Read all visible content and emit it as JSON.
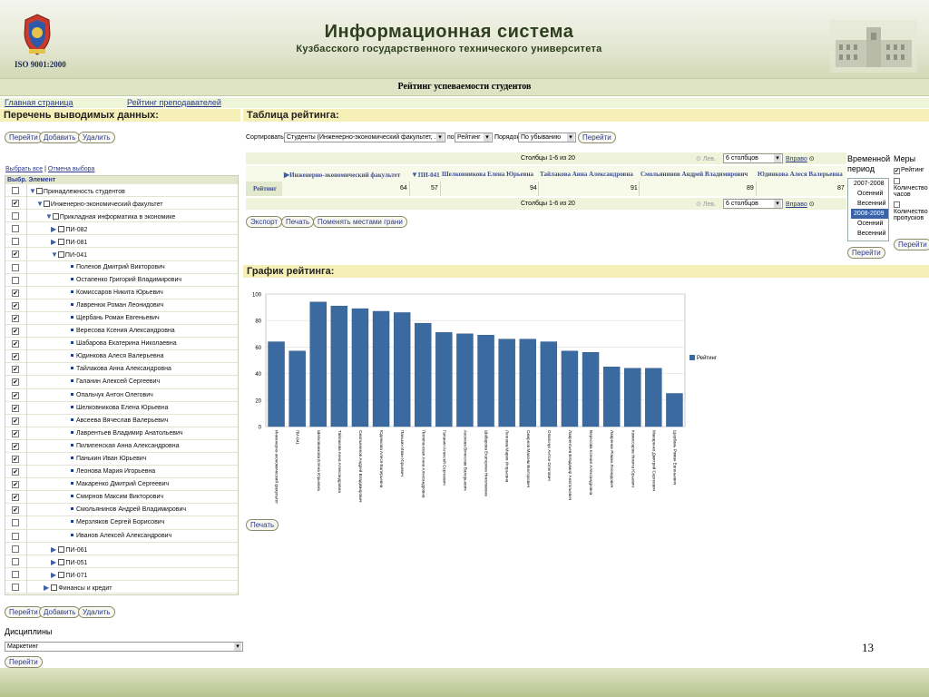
{
  "header": {
    "iso": "ISO 9001:2000",
    "title_line1": "Информационная система",
    "title_line2": "Кузбасского государственного технического университета"
  },
  "page_title": "Рейтинг успеваемости студентов",
  "nav": {
    "home": "Главная страница",
    "teachers_rating": "Рейтинг преподавателей"
  },
  "left": {
    "heading": "Перечень выводимых данных:",
    "buttons": {
      "go": "Перейти",
      "add": "Добавить",
      "remove": "Удалить"
    },
    "select_all": "Выбрать все",
    "cancel_select": "Отмена выбора",
    "col_select": "Выбр.",
    "col_element": "Элемент",
    "tree": [
      {
        "label": "Принадлежность студентов",
        "type": "root",
        "checked": false
      },
      {
        "label": "Инженерно-экономический факультет",
        "type": "folder",
        "checked": true
      },
      {
        "label": "Прикладная информатика в экономике",
        "type": "folder",
        "checked": false
      },
      {
        "label": "ПИ-082",
        "type": "group",
        "checked": false
      },
      {
        "label": "ПИ-081",
        "type": "group",
        "checked": false
      },
      {
        "label": "ПИ-041",
        "type": "group-open",
        "checked": true
      },
      {
        "label": "Полехов Дмитрий Викторович",
        "type": "student",
        "checked": false
      },
      {
        "label": "Остапенко Григорий Владимирович",
        "type": "student",
        "checked": false
      },
      {
        "label": "Комиссаров Никита Юрьевич",
        "type": "student",
        "checked": true
      },
      {
        "label": "Лавренюк Роман Леонидович",
        "type": "student",
        "checked": true
      },
      {
        "label": "Щербань Роман Евгеньевич",
        "type": "student",
        "checked": true
      },
      {
        "label": "Вересова Ксения Александровна",
        "type": "student",
        "checked": true
      },
      {
        "label": "Шабарова Екатерина Николаевна",
        "type": "student",
        "checked": true
      },
      {
        "label": "Юдинкова Алеся Валерьевна",
        "type": "student",
        "checked": true
      },
      {
        "label": "Тайлакова Анна Александровна",
        "type": "student",
        "checked": true
      },
      {
        "label": "Галанин Алексей Сергеевич",
        "type": "student",
        "checked": true
      },
      {
        "label": "Опальчук Антон Олегович",
        "type": "student",
        "checked": true
      },
      {
        "label": "Шелковникова Елена Юрьевна",
        "type": "student",
        "checked": true
      },
      {
        "label": "Авсеева Вячеслав Валерьевич",
        "type": "student",
        "checked": true
      },
      {
        "label": "Лаврентьев Владимир Анатольевич",
        "type": "student",
        "checked": true
      },
      {
        "label": "Пилипенская Анна Александровна",
        "type": "student",
        "checked": true
      },
      {
        "label": "Панькин Иван Юрьевич",
        "type": "student",
        "checked": true
      },
      {
        "label": "Леонова Мария Игорьевна",
        "type": "student",
        "checked": true
      },
      {
        "label": "Макаренко Дмитрий Сергеевич",
        "type": "student",
        "checked": true
      },
      {
        "label": "Смирнов Максим Викторович",
        "type": "student",
        "checked": true
      },
      {
        "label": "Смольянинов Андрей Владимирович",
        "type": "student",
        "checked": true
      },
      {
        "label": "Мерзляков Сергей Борисович",
        "type": "student",
        "checked": false
      },
      {
        "label": "Иванов Алексей Александрович",
        "type": "student",
        "checked": false
      },
      {
        "label": "ПИ-061",
        "type": "group",
        "checked": false
      },
      {
        "label": "ПИ-051",
        "type": "group",
        "checked": false
      },
      {
        "label": "ПИ-071",
        "type": "group",
        "checked": false
      },
      {
        "label": "Финансы и кредит",
        "type": "folder2",
        "checked": false
      }
    ],
    "disciplines_label": "Дисциплины",
    "discipline_value": "Маркетинг",
    "go2": "Перейти"
  },
  "table": {
    "heading": "Таблица рейтинга:",
    "sort_label": "Сортировать",
    "sort_value": "Студенты (Инженерно-экономический факультет, ...)",
    "by_label": "по",
    "by_value": "Рейтинг",
    "order_label": "Порядок",
    "order_value": "По убыванию",
    "go": "Перейти",
    "cols_info": "Столбцы 1-6 из 20",
    "prev": "Лев.",
    "cols_select": "6 столбцов",
    "next": "Вправо",
    "columns": [
      "Инженерно-экономический факультет",
      "ПИ-041",
      "Шелковникова Елена Юрьевна",
      "Тайлакова Анна Александровна",
      "Смольянинов Андрей Владимирович",
      "Юдинкова Алеся Валерьевна"
    ],
    "row_label": "Рейтинг",
    "values": [
      "64",
      "57",
      "94",
      "91",
      "89",
      "87"
    ],
    "export": "Экспорт",
    "print": "Печать",
    "swap": "Поменять местами грани"
  },
  "period": {
    "label": "Временной период",
    "items": [
      "2007-2008",
      "Осенний",
      "Весенний",
      "2008-2009",
      "Осенний",
      "Весенний"
    ],
    "selected_index": 3,
    "go": "Перейти"
  },
  "measures": {
    "label": "Меры",
    "items": [
      {
        "label": "Рейтинг",
        "checked": true
      },
      {
        "label": "Количество часов",
        "checked": false
      },
      {
        "label": "Количество пропусков",
        "checked": false
      }
    ],
    "go": "Перейти"
  },
  "chart_section": {
    "heading": "График рейтинга:",
    "print": "Печать"
  },
  "chart_data": {
    "type": "bar",
    "ylim": [
      0,
      100
    ],
    "yticks": [
      0,
      20,
      40,
      60,
      80,
      100
    ],
    "legend": "Рейтинг",
    "categories": [
      "Инженерно-экономический факультет",
      "ПИ-041",
      "Шелковникова Елена Юрьевна",
      "Тайлакова Анна Александровна",
      "Смольянинов Андрей Владимирович",
      "Юдинкова Алеся Валерьевна",
      "Панькин Иван Юрьевич",
      "Пилипенская Анна Александровна",
      "Галанин Алексей Сергеевич",
      "Авсеева Вячеслав Валерьевич",
      "Шабарова Екатерина Николаевна",
      "Леонова Мария Игорьевна",
      "Смирнов Максим Викторович",
      "Опальчук Антон Олегович",
      "Лаврентьев Владимир Анатольевич",
      "Вересова Ксения Александровна",
      "Лавренюк Роман Леонидович",
      "Комиссаров Никита Юрьевич",
      "Макаренко Дмитрий Сергеевич",
      "Щербань Роман Евгеньевич"
    ],
    "values": [
      64,
      57,
      94,
      91,
      89,
      87,
      86,
      78,
      71,
      70,
      69,
      66,
      66,
      64,
      57,
      56,
      45,
      44,
      44,
      25
    ]
  },
  "slide_number": "13"
}
